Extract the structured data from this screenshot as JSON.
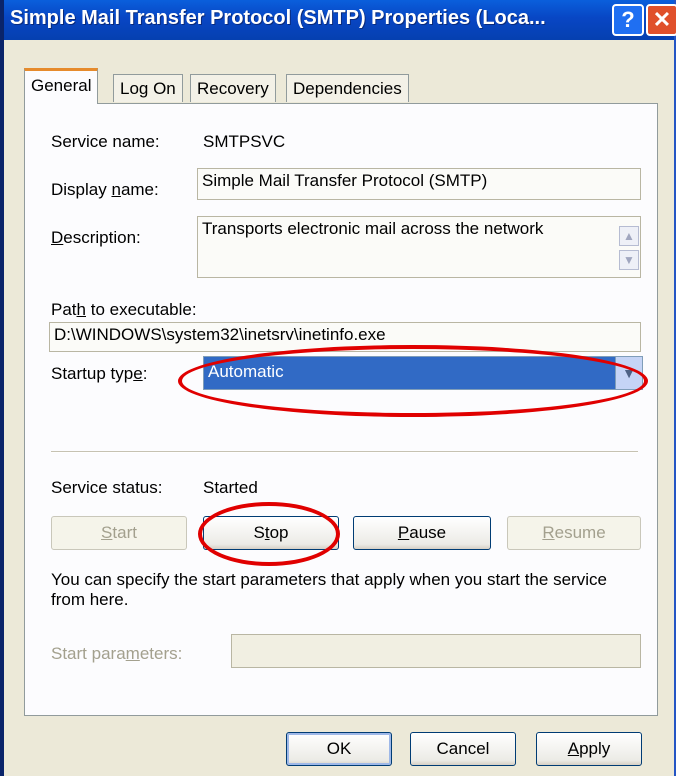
{
  "window": {
    "title": "Simple Mail Transfer Protocol (SMTP) Properties (Loca...",
    "help_glyph": "?",
    "close_glyph": "✕"
  },
  "tabs": [
    {
      "label": "General"
    },
    {
      "label": "Log On"
    },
    {
      "label": "Recovery"
    },
    {
      "label": "Dependencies"
    }
  ],
  "general": {
    "service_name_label": "Service name:",
    "service_name_value": "SMTPSVC",
    "display_name_label": [
      "Display ",
      "n",
      "ame:"
    ],
    "display_name_value": "Simple Mail Transfer Protocol (SMTP)",
    "description_label": [
      "",
      "D",
      "escription:"
    ],
    "description_value": "Transports electronic mail across the network",
    "path_label": [
      "Pat",
      "h",
      " to executable:"
    ],
    "path_value": "D:\\WINDOWS\\system32\\inetsrv\\inetinfo.exe",
    "startup_type_label": [
      "Startup typ",
      "e",
      ":"
    ],
    "startup_type_value": "Automatic",
    "service_status_label": "Service status:",
    "service_status_value": "Started",
    "buttons": {
      "start": [
        "",
        "S",
        "tart"
      ],
      "stop": [
        "S",
        "t",
        "op"
      ],
      "pause": [
        "",
        "P",
        "ause"
      ],
      "resume": [
        "",
        "R",
        "esume"
      ]
    },
    "hint_text": "You can specify the start parameters that apply when you start the service from here.",
    "start_params_label": [
      "Start para",
      "m",
      "eters:"
    ],
    "start_params_value": ""
  },
  "footer": {
    "ok": "OK",
    "cancel": "Cancel",
    "apply": [
      "",
      "A",
      "pply"
    ]
  },
  "colors": {
    "annotation": "#e00000",
    "selection": "#316ac5",
    "active_tab_accent": "#e68b2c"
  }
}
